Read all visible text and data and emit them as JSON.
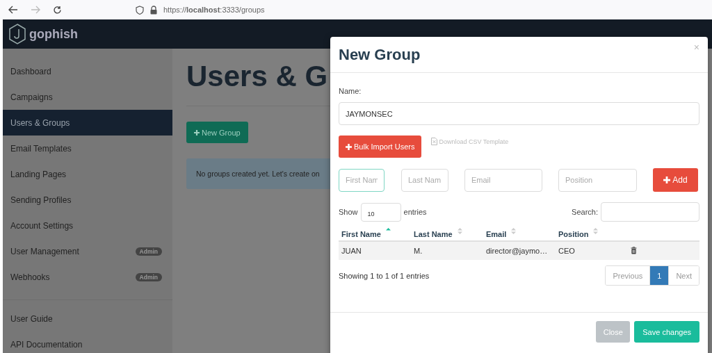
{
  "browser": {
    "url": "https://**localhost**:3333/groups",
    "forward_disabled": true
  },
  "navbar": {
    "brand": "gophish"
  },
  "sidebar": {
    "items": [
      {
        "label": "Dashboard",
        "selected": false
      },
      {
        "label": "Campaigns",
        "selected": false
      },
      {
        "label": "Users & Groups",
        "selected": true
      },
      {
        "label": "Email Templates",
        "selected": false
      },
      {
        "label": "Landing Pages",
        "selected": false
      },
      {
        "label": "Sending Profiles",
        "selected": false
      },
      {
        "label": "Account Settings",
        "selected": false
      },
      {
        "label": "User Management",
        "selected": false,
        "badge": "Admin"
      },
      {
        "label": "Webhooks",
        "selected": false,
        "badge": "Admin"
      }
    ],
    "help_items": [
      {
        "label": "User Guide",
        "selected": false
      },
      {
        "label": "API Documentation",
        "selected": false
      }
    ]
  },
  "main": {
    "title": "Users & G",
    "new_button": "New Group",
    "alert": "No groups created yet. Let's create on"
  },
  "modal": {
    "title": "New Group",
    "close": "×",
    "name_label": "Name:",
    "name_value": "JAYMONSEC",
    "bulk_button": "Bulk Import Users",
    "csv_link": "Download CSV Template",
    "new_user_fields": [
      {
        "placeholder": "First Nam",
        "focused": true
      },
      {
        "placeholder": "Last Nam",
        "focused": false
      },
      {
        "placeholder": "Email",
        "focused": false
      },
      {
        "placeholder": "Position",
        "focused": false
      }
    ],
    "add_button": "Add",
    "show_label": "Show",
    "entries_value": "10",
    "entries_label": "entries",
    "search_label": "Search:",
    "table": {
      "columns": [
        {
          "label": "First Name",
          "sorted": true
        },
        {
          "label": "Last Name",
          "sorted": false
        },
        {
          "label": "Email",
          "sorted": false
        },
        {
          "label": "Position",
          "sorted": false
        }
      ],
      "rows": [
        {
          "cells": [
            "JUAN",
            "M.",
            "director@jaymo…",
            "CEO"
          ]
        }
      ]
    },
    "info": "Showing 1 to 1 of 1 entries",
    "pages": [
      {
        "label": "Previous",
        "selected": false
      },
      {
        "label": "1",
        "selected": true
      },
      {
        "label": "Next",
        "selected": false
      }
    ],
    "buttons": [
      {
        "label": "Close",
        "kind": "secondary"
      },
      {
        "label": "Save changes",
        "kind": "primary"
      }
    ]
  }
}
